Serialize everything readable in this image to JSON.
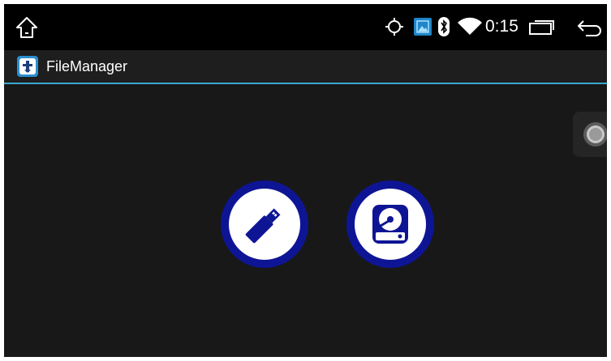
{
  "status_bar": {
    "time": "0:15",
    "icons": [
      "home-icon",
      "gps-icon",
      "image-icon",
      "bluetooth-icon",
      "wifi-icon",
      "recents-icon",
      "back-icon"
    ]
  },
  "app": {
    "title": "FileManager",
    "icon": "file-manager-icon"
  },
  "storage": [
    {
      "type": "usb",
      "icon": "usb-drive-icon"
    },
    {
      "type": "hard-disk",
      "icon": "hard-disk-icon"
    }
  ],
  "colors": {
    "background": "#181818",
    "status_bar": "#000000",
    "title_bar": "#1e1e1e",
    "accent_line": "#3aa6cf",
    "storage_ring": "#0e1595"
  }
}
